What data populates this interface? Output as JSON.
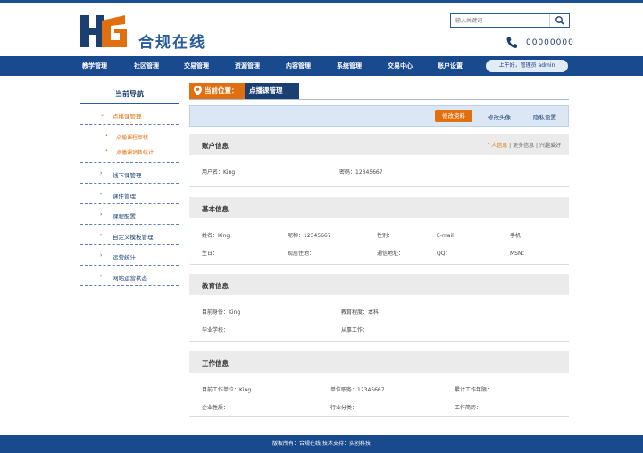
{
  "header": {
    "logo_text": "合规在线",
    "logo_lettering": "HG",
    "search_placeholder": "输入关键词",
    "phone": "00000000"
  },
  "nav": {
    "items": [
      "教学管理",
      "社区管理",
      "交易管理",
      "资源管理",
      "内容管理",
      "系统管理",
      "交易中心",
      "账户设置"
    ],
    "user_greeting": "上午好，管理员 admin"
  },
  "sidebar": {
    "title": "当前导航",
    "active_item": "点播课管理",
    "sub_items": [
      "点播课程审核",
      "点播课销售统计"
    ],
    "items": [
      "线下课管理",
      "课件管理",
      "课程配置",
      "自定义模板管理",
      "运营统计",
      "网站运营状态"
    ]
  },
  "location": {
    "label": "当前位置：",
    "current": "点播课管理"
  },
  "tabs": {
    "active": "修改资料",
    "others": [
      "修改头像",
      "隐私设置"
    ]
  },
  "account": {
    "title": "账户信息",
    "links": [
      "个人信息",
      "更多信息",
      "兴趣爱好"
    ],
    "username": "用户名：King",
    "password": "密码：12345667"
  },
  "basic": {
    "title": "基本信息",
    "row1": [
      "姓名：King",
      "昵称：12345667",
      "性别：",
      "E-mail：",
      "手机："
    ],
    "row2": [
      "生日：",
      "现居住地：",
      "通信地址：",
      "QQ：",
      "MSN："
    ]
  },
  "education": {
    "title": "教育信息",
    "row1": [
      "目前身份：King",
      "教育程度：本科"
    ],
    "row2": [
      "毕业学校：",
      "从事工作："
    ]
  },
  "work": {
    "title": "工作信息",
    "row1": [
      "目前工作单位：King",
      "单位职务：12345667",
      "累计工作年限："
    ],
    "row2": [
      "企业性质：",
      "行业分类：",
      "工作简历："
    ]
  },
  "footer": {
    "text": "版权所有：合规在线    技术支持：实创科技"
  },
  "colors": {
    "brand_blue": "#1a4a8e",
    "accent_orange": "#e0700f"
  }
}
